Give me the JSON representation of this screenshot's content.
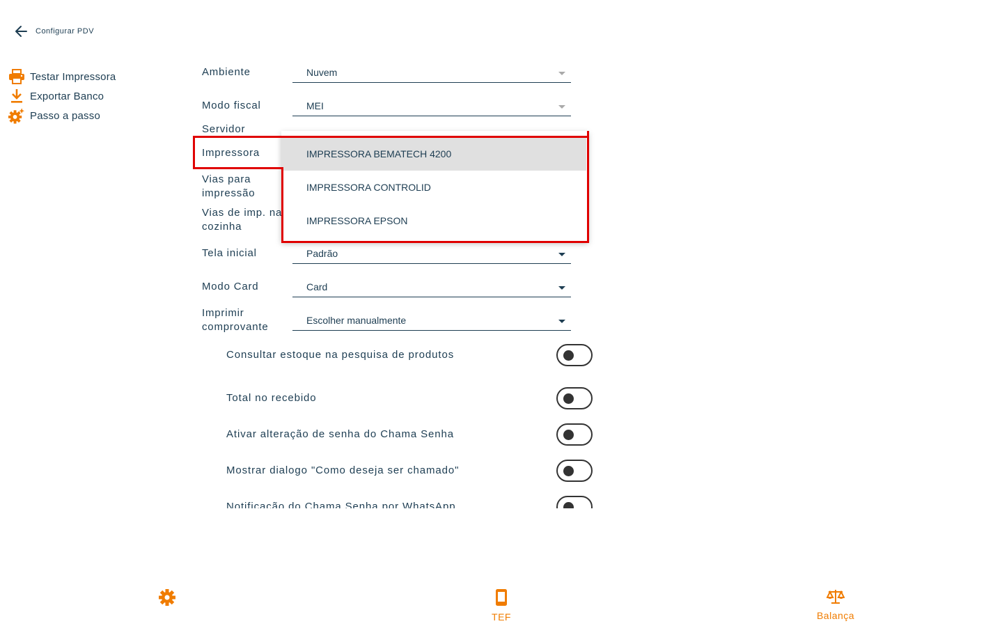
{
  "header": {
    "title": "Configurar PDV",
    "back_icon": "arrow-left-icon"
  },
  "sidebar": {
    "items": [
      {
        "label": "Testar Impressora",
        "icon": "printer-icon"
      },
      {
        "label": "Exportar Banco",
        "icon": "download-icon"
      },
      {
        "label": "Passo a passo",
        "icon": "settings-sparkle-icon"
      }
    ]
  },
  "form": {
    "ambiente": {
      "label": "Ambiente",
      "value": "Nuvem"
    },
    "modo_fiscal": {
      "label": "Modo fiscal",
      "value": "MEI"
    },
    "servidor": {
      "label": "Servidor"
    },
    "impressora": {
      "label": "Impressora"
    },
    "vias_impressao": {
      "label": "Vias para impressão"
    },
    "vias_cozinha": {
      "label": "Vias de imp. na cozinha"
    },
    "tela_inicial": {
      "label": "Tela inicial",
      "value": "Padrão"
    },
    "modo_card": {
      "label": "Modo Card",
      "value": "Card"
    },
    "imprimir_comprovante": {
      "label": "Imprimir comprovante",
      "value": "Escolher manualmente"
    }
  },
  "toggles": [
    {
      "label": "Consultar estoque na pesquisa de produtos",
      "on": false
    },
    {
      "label": "Total no recebido",
      "on": false
    },
    {
      "label": "Ativar alteração de senha do Chama Senha",
      "on": false
    },
    {
      "label": "Mostrar dialogo \"Como deseja ser chamado\"",
      "on": false
    },
    {
      "label": "Notificação do Chama Senha por WhatsApp",
      "on": false
    }
  ],
  "dropdown": {
    "options": [
      {
        "label": "IMPRESSORA BEMATECH 4200",
        "selected": true
      },
      {
        "label": "IMPRESSORA CONTROLID",
        "selected": false
      },
      {
        "label": "IMPRESSORA EPSON",
        "selected": false
      }
    ]
  },
  "bottom_nav": [
    {
      "label": "",
      "icon": "gear-icon"
    },
    {
      "label": "TEF",
      "icon": "smartphone-icon"
    },
    {
      "label": "Balança",
      "icon": "scale-icon"
    }
  ],
  "colors": {
    "accent": "#f07c00",
    "text": "#1d3d52",
    "highlight": "#e00000"
  }
}
